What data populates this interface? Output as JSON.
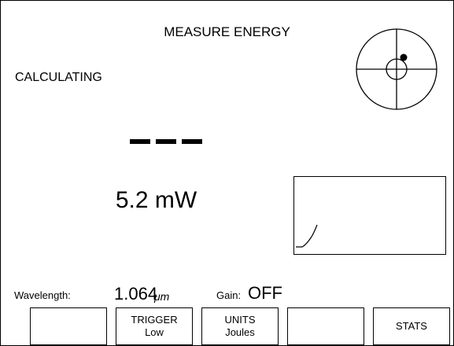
{
  "screen": {
    "title": "MEASURE ENERGY",
    "status": "CALCULATING",
    "reading_placeholder": "---",
    "reading": "5.2 mW"
  },
  "icons": {
    "reticle": "target-reticle-icon",
    "dashes": "dash-placeholder-icon"
  },
  "status_line": {
    "wavelength_label": "Wavelength:",
    "wavelength_value": "1.064",
    "wavelength_unit": "μm",
    "gain_label": "Gain:",
    "gain_value": "OFF"
  },
  "softkeys": [
    {
      "line1": "",
      "line2": ""
    },
    {
      "line1": "TRIGGER",
      "line2": "Low"
    },
    {
      "line1": "UNITS",
      "line2": "Joules"
    },
    {
      "line1": "",
      "line2": ""
    },
    {
      "line1": "STATS",
      "line2": ""
    }
  ]
}
